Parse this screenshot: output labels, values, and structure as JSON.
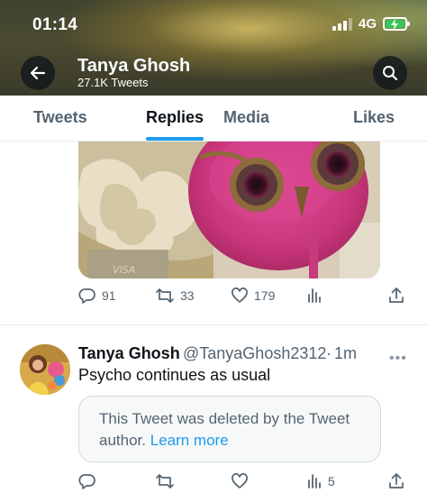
{
  "status_bar": {
    "time": "01:14",
    "network": "4G"
  },
  "header": {
    "name": "Tanya Ghosh",
    "tweet_count": "27.1K Tweets"
  },
  "tabs": [
    {
      "label": "Tweets",
      "active": false
    },
    {
      "label": "Replies",
      "active": true
    },
    {
      "label": "Media",
      "active": false
    },
    {
      "label": "Likes",
      "active": false
    }
  ],
  "tweet1": {
    "media_icon": "owl-brooch-photo",
    "reply_count": "91",
    "retweet_count": "33",
    "like_count": "179"
  },
  "tweet2": {
    "name": "Tanya Ghosh",
    "handle": "@TanyaGhosh2312",
    "dot": "·",
    "time": "1m",
    "more": "•••",
    "text": "Psycho continues as usual",
    "deleted_notice": "This Tweet was deleted by the Tweet author.",
    "learn_more": "Learn more",
    "views_count": "5"
  },
  "colors": {
    "accent": "#1d9bf0",
    "battery": "#34c759",
    "muted": "#536471"
  }
}
